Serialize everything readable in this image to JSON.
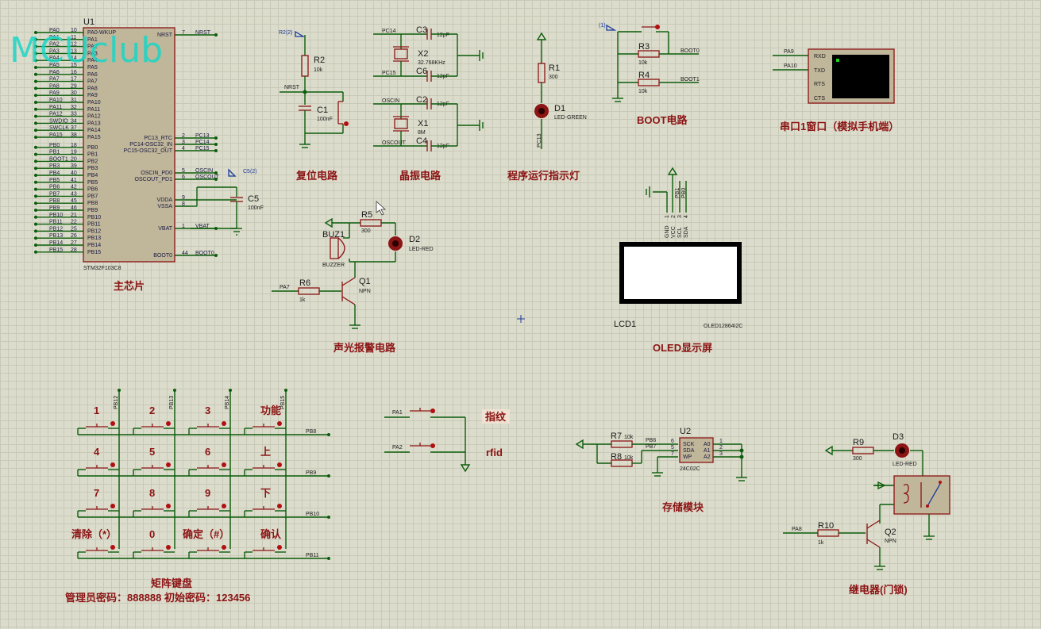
{
  "watermark": "MCUclub",
  "mcu": {
    "ref": "U1",
    "part": "STM32F103C8",
    "label": "主芯片",
    "left_pins": [
      {
        "net": "PA0",
        "num": "10",
        "name": "PA0-WKUP"
      },
      {
        "net": "PA1",
        "num": "11",
        "name": "PA1"
      },
      {
        "net": "PA2",
        "num": "12",
        "name": "PA2"
      },
      {
        "net": "PA3",
        "num": "13",
        "name": "PA3"
      },
      {
        "net": "PA4",
        "num": "14",
        "name": "PA4"
      },
      {
        "net": "PA5",
        "num": "15",
        "name": "PA5"
      },
      {
        "net": "PA6",
        "num": "16",
        "name": "PA6"
      },
      {
        "net": "PA7",
        "num": "17",
        "name": "PA7"
      },
      {
        "net": "PA8",
        "num": "29",
        "name": "PA8"
      },
      {
        "net": "PA9",
        "num": "30",
        "name": "PA9"
      },
      {
        "net": "PA10",
        "num": "31",
        "name": "PA10"
      },
      {
        "net": "PA11",
        "num": "32",
        "name": "PA11"
      },
      {
        "net": "PA12",
        "num": "33",
        "name": "PA12"
      },
      {
        "net": "SWDIO",
        "num": "34",
        "name": "PA13"
      },
      {
        "net": "SWCLK",
        "num": "37",
        "name": "PA14"
      },
      {
        "net": "PA15",
        "num": "38",
        "name": "PA15"
      },
      {
        "net": "PB0",
        "num": "18",
        "name": "PB0"
      },
      {
        "net": "PB1",
        "num": "19",
        "name": "PB1"
      },
      {
        "net": "BOOT1",
        "num": "20",
        "name": "PB2"
      },
      {
        "net": "PB3",
        "num": "39",
        "name": "PB3"
      },
      {
        "net": "PB4",
        "num": "40",
        "name": "PB4"
      },
      {
        "net": "PB5",
        "num": "41",
        "name": "PB5"
      },
      {
        "net": "PB6",
        "num": "42",
        "name": "PB6"
      },
      {
        "net": "PB7",
        "num": "43",
        "name": "PB7"
      },
      {
        "net": "PB8",
        "num": "45",
        "name": "PB8"
      },
      {
        "net": "PB9",
        "num": "46",
        "name": "PB9"
      },
      {
        "net": "PB10",
        "num": "21",
        "name": "PB10"
      },
      {
        "net": "PB11",
        "num": "22",
        "name": "PB11"
      },
      {
        "net": "PB12",
        "num": "25",
        "name": "PB12"
      },
      {
        "net": "PB13",
        "num": "26",
        "name": "PB13"
      },
      {
        "net": "PB14",
        "num": "27",
        "name": "PB14"
      },
      {
        "net": "PB15",
        "num": "28",
        "name": "PB15"
      }
    ],
    "right_pins": [
      {
        "name": "NRST",
        "num": "7",
        "net": "NRST"
      },
      {
        "name": "PC13_RTC",
        "num": "2",
        "net": "PC13"
      },
      {
        "name": "PC14-OSC32_IN",
        "num": "3",
        "net": "PC14"
      },
      {
        "name": "PC15-OSC32_OUT",
        "num": "4",
        "net": "PC15"
      },
      {
        "name": "OSCIN_PD0",
        "num": "5",
        "net": "OSCIN"
      },
      {
        "name": "OSCOUT_PD1",
        "num": "6",
        "net": "OSCOUT"
      },
      {
        "name": "VDDA",
        "num": "9",
        "net": ""
      },
      {
        "name": "VSSA",
        "num": "8",
        "net": ""
      },
      {
        "name": "VBAT",
        "num": "1",
        "net": "VBAT"
      },
      {
        "name": "BOOT0",
        "num": "44",
        "net": "BOOT0"
      }
    ],
    "c5": {
      "ref": "C5",
      "value": "100nF",
      "probe": "C5(2)"
    }
  },
  "reset": {
    "label": "复位电路",
    "probe": "R2(2)",
    "r2": {
      "ref": "R2",
      "value": "10k"
    },
    "c1": {
      "ref": "C1",
      "value": "100nF"
    },
    "net": "NRST"
  },
  "crystal": {
    "label": "晶振电路",
    "nets": [
      "PC14",
      "PC15",
      "OSCIN",
      "OSCOUT"
    ],
    "c3": {
      "ref": "C3",
      "value": "12pF"
    },
    "c6": {
      "ref": "C6",
      "value": "12pF"
    },
    "c2": {
      "ref": "C2",
      "value": "12pF"
    },
    "c4": {
      "ref": "C4",
      "value": "12pF"
    },
    "x2": {
      "ref": "X2",
      "value": "32.768KHz"
    },
    "x1": {
      "ref": "X1",
      "value": "8M"
    }
  },
  "runled": {
    "label": "程序运行指示灯",
    "r1": {
      "ref": "R1",
      "value": "300"
    },
    "d1": {
      "ref": "D1",
      "value": "LED-GREEN"
    },
    "net": "PC13"
  },
  "boot": {
    "label": "BOOT电路",
    "probe": "(1)",
    "r3": {
      "ref": "R3",
      "value": "10k"
    },
    "r4": {
      "ref": "R4",
      "value": "10k"
    },
    "nets": [
      "BOOT0",
      "BOOT1"
    ]
  },
  "uart": {
    "label": "串口1窗口（模拟手机端）",
    "nets": [
      "PA9",
      "PA10"
    ],
    "pins": [
      "RXD",
      "TXD",
      "RTS",
      "CTS"
    ]
  },
  "alarm": {
    "label": "声光报警电路",
    "r5": {
      "ref": "R5",
      "value": "300"
    },
    "d2": {
      "ref": "D2",
      "value": "LED-RED"
    },
    "buz": {
      "ref": "BUZ1",
      "value": "BUZZER"
    },
    "r6": {
      "ref": "R6",
      "value": "1k"
    },
    "q1": {
      "ref": "Q1",
      "value": "NPN"
    },
    "net": "PA7"
  },
  "oled": {
    "label": "OLED显示屏",
    "ref": "LCD1",
    "part": "OLED12864I2C",
    "pins": [
      "GND",
      "VCC",
      "SCL",
      "SDA"
    ],
    "pin_nums": [
      "1",
      "2",
      "3",
      "4"
    ],
    "nets": [
      "PB1",
      "PB0"
    ]
  },
  "keypad": {
    "label": "矩阵键盘",
    "note": "管理员密码：888888   初始密码：123456",
    "cols": [
      "PB12",
      "PB13",
      "PB14",
      "PB15"
    ],
    "rows": [
      "PB8",
      "PB9",
      "PB10",
      "PB11"
    ],
    "keys": [
      "1",
      "2",
      "3",
      "功能",
      "4",
      "5",
      "6",
      "上",
      "7",
      "8",
      "9",
      "下",
      "清除（*）",
      "0",
      "确定（#）",
      "确认"
    ]
  },
  "buttons": {
    "nets": [
      "PA1",
      "PA2"
    ],
    "labels": [
      "指纹",
      "rfid"
    ]
  },
  "storage": {
    "label": "存储模块",
    "r7": {
      "ref": "R7",
      "value": "10k"
    },
    "r8": {
      "ref": "R8",
      "value": "10k"
    },
    "nets": [
      "PB6",
      "PB7"
    ],
    "u2": {
      "ref": "U2",
      "part": "24C02C"
    },
    "pins_left": [
      "SCK",
      "SDA",
      "WP"
    ],
    "pins_right": [
      "A0",
      "A1",
      "A2"
    ],
    "nums_left": [
      "6",
      "5",
      "7"
    ],
    "nums_right": [
      "1",
      "2",
      "3"
    ]
  },
  "relay": {
    "label": "继电器(门锁)",
    "r9": {
      "ref": "R9",
      "value": "300"
    },
    "d3": {
      "ref": "D3",
      "value": "LED-RED"
    },
    "r10": {
      "ref": "R10",
      "value": "1k"
    },
    "q2": {
      "ref": "Q2",
      "value": "NPN"
    },
    "net": "PA8"
  }
}
